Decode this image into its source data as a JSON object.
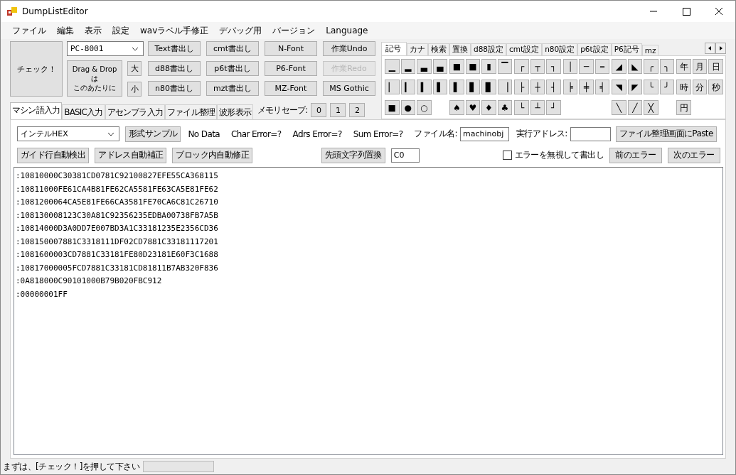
{
  "window": {
    "title": "DumpListEditor"
  },
  "menu": [
    "ファイル",
    "編集",
    "表示",
    "設定",
    "wavラベル手修正",
    "デバッグ用",
    "バージョン",
    "Language"
  ],
  "toolbar": {
    "check_button": "チェック！",
    "machine": {
      "value": "PC-8001"
    },
    "drop_zone": [
      "Drag & Drop",
      "は",
      "このあたりに"
    ],
    "size_buttons": [
      "大",
      "小"
    ],
    "columns": [
      [
        {
          "label": "Text書出し",
          "disabled": false
        },
        {
          "label": "d88書出し",
          "disabled": false
        },
        {
          "label": "n80書出し",
          "disabled": false
        }
      ],
      [
        {
          "label": "cmt書出し",
          "disabled": false
        },
        {
          "label": "p6t書出し",
          "disabled": false
        },
        {
          "label": "mzt書出し",
          "disabled": false
        }
      ],
      [
        {
          "label": "N-Font",
          "disabled": false
        },
        {
          "label": "P6-Font",
          "disabled": false
        },
        {
          "label": "MZ-Font",
          "disabled": false
        }
      ],
      [
        {
          "label": "作業Undo",
          "disabled": false
        },
        {
          "label": "作業Redo",
          "disabled": true
        },
        {
          "label": "MS Gothic",
          "disabled": false
        }
      ]
    ]
  },
  "mode_tabs": [
    {
      "label": "マシン語入力",
      "selected": true
    },
    {
      "label": "BASIC入力",
      "selected": false
    },
    {
      "label": "アセンブラ入力",
      "selected": false
    },
    {
      "label": "ファイル整理",
      "selected": false
    },
    {
      "label": "波形表示",
      "selected": false
    }
  ],
  "memory_save": {
    "label": "メモリセーブ:",
    "slots": [
      "0",
      "1",
      "2"
    ]
  },
  "symbol_tabs": [
    {
      "label": "記号",
      "selected": true
    },
    {
      "label": "カナ",
      "selected": false
    },
    {
      "label": "検索",
      "selected": false
    },
    {
      "label": "置換",
      "selected": false
    },
    {
      "label": "d88設定",
      "selected": false
    },
    {
      "label": "cmt設定",
      "selected": false
    },
    {
      "label": "n80設定",
      "selected": false
    },
    {
      "label": "p6t設定",
      "selected": false
    },
    {
      "label": "P6記号",
      "selected": false
    },
    {
      "label": "mz",
      "selected": false
    }
  ],
  "symbol_rows": [
    {
      "blocks": [
        "▁",
        "▂",
        "▃",
        "▄"
      ],
      "bars": [
        "■",
        "■",
        "▮",
        "▔"
      ],
      "corners": [
        "┌",
        "┬",
        "┐"
      ],
      "lines": [
        "│",
        "─",
        "＝"
      ],
      "shapes": [
        "◢",
        "◣",
        "╭",
        "╮"
      ],
      "kanji": [
        "年",
        "月",
        "日"
      ]
    },
    {
      "blocks": [
        "▏",
        "▎",
        "▍",
        "▌"
      ],
      "bars": [
        "▌",
        "▋",
        "▊",
        "▕"
      ],
      "corners": [
        "├",
        "┼",
        "┤"
      ],
      "lines": [
        "╞",
        "╪",
        "╡"
      ],
      "shapes": [
        "◥",
        "◤",
        "╰",
        "╯"
      ],
      "kanji": [
        "時",
        "分",
        "秒"
      ]
    },
    {
      "blocks": [
        "■",
        "●",
        "○"
      ],
      "bars": [
        "♠",
        "♥",
        "♦",
        "♣"
      ],
      "corners": [
        "└",
        "┴",
        "┘"
      ],
      "shapes": [
        "╲",
        "╱",
        "╳"
      ],
      "kanji": [
        "円"
      ]
    }
  ],
  "machine_panel": {
    "format": {
      "value": "インテルHEX"
    },
    "sample_button": "形式サンプル",
    "status": "No Data",
    "errors": [
      "Char Error=?",
      "Adrs Error=?",
      "Sum Error=?"
    ],
    "file_name": {
      "label": "ファイル名:",
      "value": "machinobj"
    },
    "exec_address": {
      "label": "実行アドレス:"
    },
    "paste_button": "ファイル整理画面にPaste",
    "fix_buttons": [
      "ガイド行自動検出",
      "アドレス自動補正",
      "ブロック内自動修正"
    ],
    "replace_button": "先頭文字列置換",
    "replace_value": "C0",
    "ignore_errors": {
      "label": "エラーを無視して書出し",
      "checked": false
    },
    "prev_error": "前のエラー",
    "next_error": "次のエラー",
    "lines": [
      ":10810000C30381CD0781C92100827EFE55CA368115",
      ":10811000FE61CA4B81FE62CA5581FE63CA5E81FE62",
      ":1081200064CA5E81FE66CA3581FE70CA6C81C26710",
      ":108130008123C30A81C92356235EDBA00738FB7A5B",
      ":10814000D3A0DD7E007BD3A1C33181235E2356CD36",
      ":108150007881C3318111DF02CD7881C33181117201",
      ":1081600003CD7881C33181FE80D23181E60F3C1688",
      ":10817000005FCD7881C33181CD81811B7AB320F836",
      ":0A818000C90101000B79B020FBC912",
      ":00000001FF"
    ]
  },
  "status_bar": {
    "message": "まずは、[チェック！]を押して下さい"
  }
}
